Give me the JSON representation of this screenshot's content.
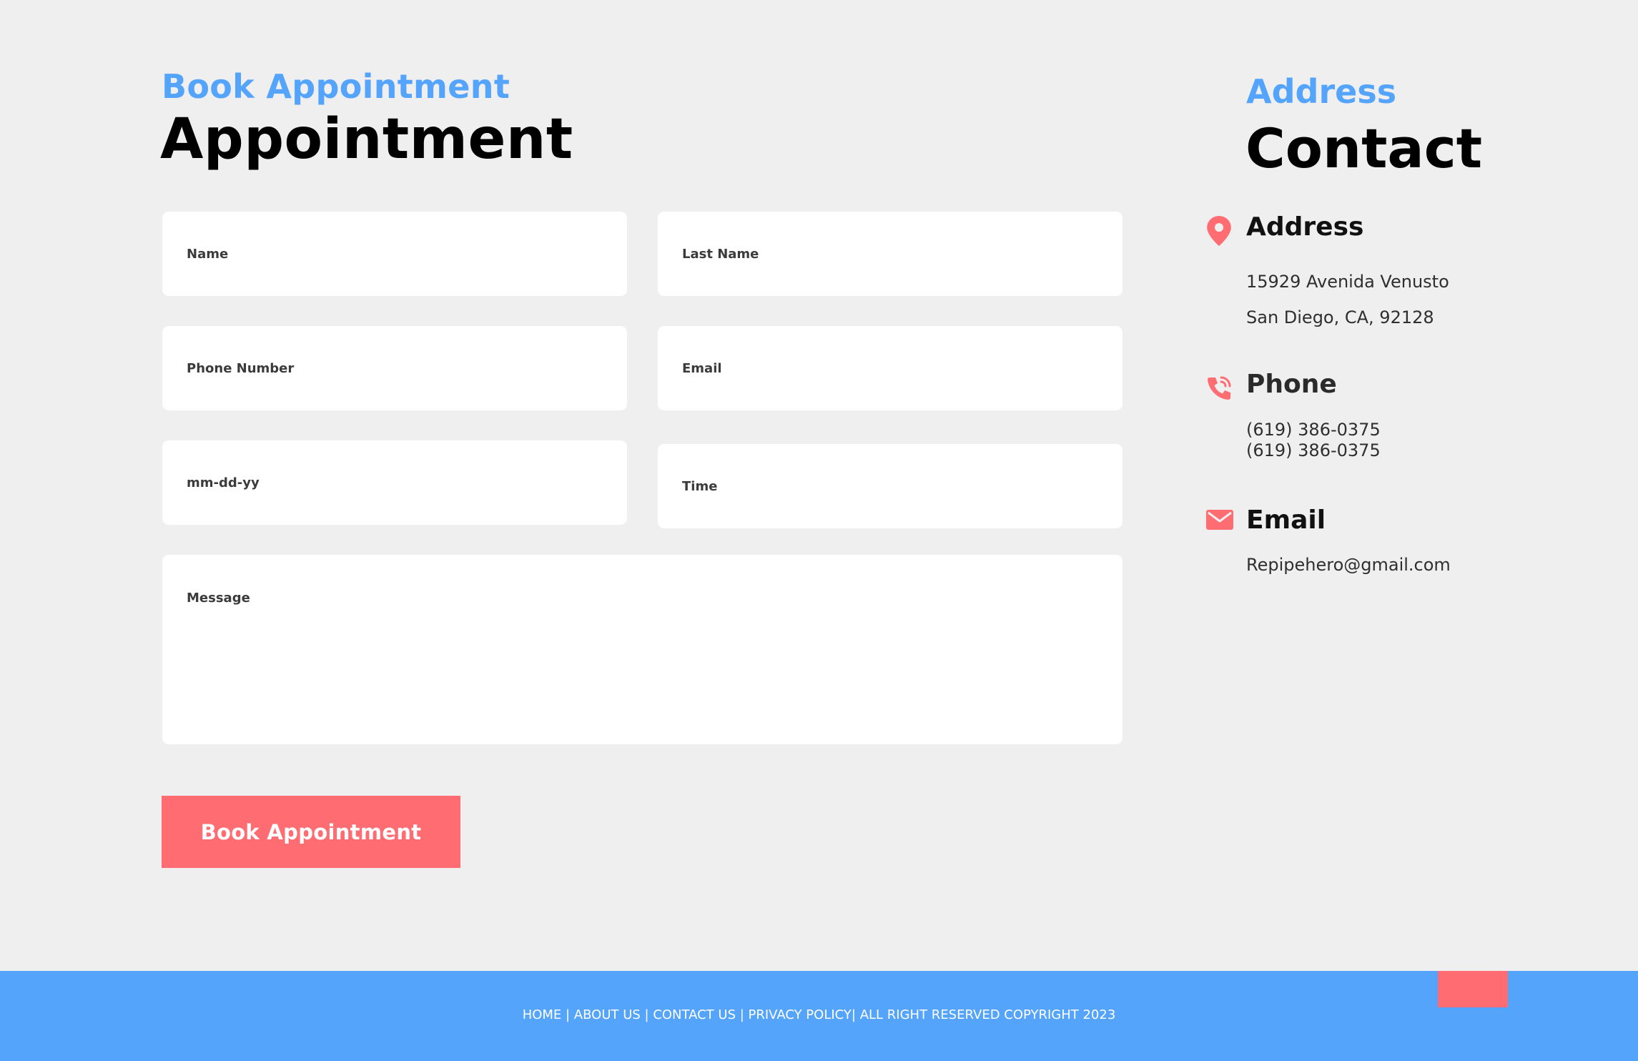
{
  "form": {
    "eyebrow": "Book Appointment",
    "title": "Appointment",
    "fields": {
      "name": {
        "placeholder": "Name",
        "value": ""
      },
      "last_name": {
        "placeholder": "Last Name",
        "value": ""
      },
      "phone": {
        "placeholder": "Phone Number",
        "value": ""
      },
      "email": {
        "placeholder": "Email",
        "value": ""
      },
      "date": {
        "placeholder": "mm-dd-yy",
        "value": ""
      },
      "time": {
        "placeholder": "Time",
        "value": ""
      },
      "message": {
        "placeholder": "Message",
        "value": ""
      }
    },
    "submit_label": "Book Appointment"
  },
  "contact": {
    "eyebrow": "Address",
    "title": "Contact",
    "address": {
      "heading": "Address",
      "line1": "15929 Avenida Venusto",
      "line2": "San Diego, CA, 92128",
      "icon": "map-pin-icon"
    },
    "phone": {
      "heading": "Phone",
      "line1": "(619) 386-0375",
      "line2": "(619) 386-0375",
      "icon": "phone-icon"
    },
    "email": {
      "heading": "Email",
      "value": "Repipehero@gmail.com",
      "icon": "envelope-icon"
    },
    "accent_color": "#ff6d73"
  },
  "footer": {
    "text": "HOME | ABOUT US | CONTACT US | PRIVACY POLICY| ALL RIGHT RESERVED COPYRIGHT 2023"
  },
  "colors": {
    "brand_blue": "#55a4fb",
    "accent_coral": "#ff6d73",
    "background": "#efefef"
  }
}
